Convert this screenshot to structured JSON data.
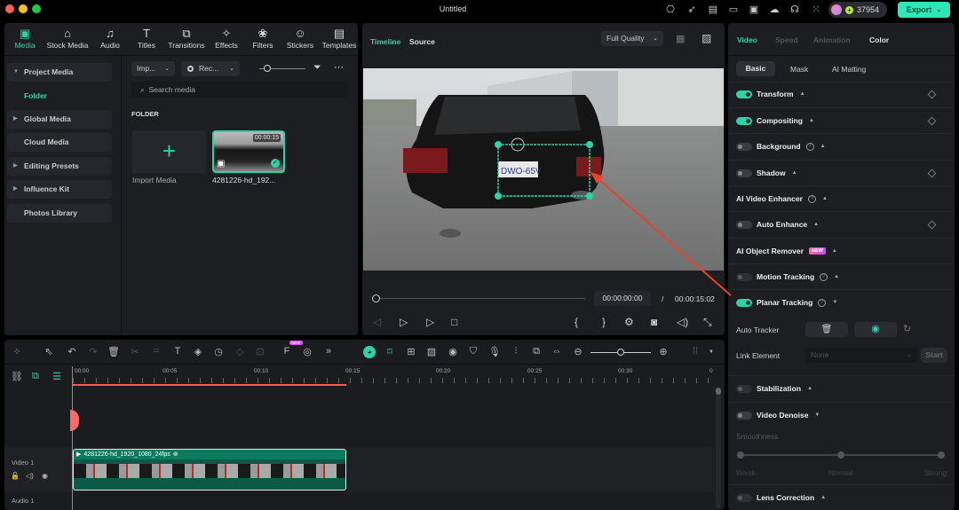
{
  "window": {
    "title": "Untitled"
  },
  "titlebar": {
    "credits": "37954",
    "export_label": "Export",
    "icons": [
      "gift-icon",
      "send-icon",
      "message-icon",
      "layout-icon",
      "save-icon",
      "cloud-upload-icon",
      "headset-icon",
      "apps-icon"
    ]
  },
  "media_tabs": [
    {
      "label": "Media",
      "icon": "▣"
    },
    {
      "label": "Stock Media",
      "icon": "⌂"
    },
    {
      "label": "Audio",
      "icon": "♫"
    },
    {
      "label": "Titles",
      "icon": "T"
    },
    {
      "label": "Transitions",
      "icon": "⧉"
    },
    {
      "label": "Effects",
      "icon": "✧"
    },
    {
      "label": "Filters",
      "icon": "❀"
    },
    {
      "label": "Stickers",
      "icon": "☺"
    },
    {
      "label": "Templates",
      "icon": "▤"
    }
  ],
  "sidebar": {
    "project_media": "Project Media",
    "folder": "Folder",
    "global_media": "Global Media",
    "cloud_media": "Cloud Media",
    "editing_presets": "Editing Presets",
    "influence_kit": "Influence Kit",
    "photos_library": "Photos Library"
  },
  "media": {
    "import_dd": "Imp...",
    "record_dd": "Rec...",
    "search_placeholder": "Search media",
    "folder_heading": "FOLDER",
    "import_label": "Import Media",
    "clip_name": "4281226-hd_192...",
    "clip_duration": "00:00:15"
  },
  "preview": {
    "tab_timeline": "Timeline",
    "tab_source": "Source",
    "quality": "Full Quality",
    "current_time": "00:00:00:00",
    "separator": "/",
    "total_time": "00:00:15:02",
    "plate": "DWO-65V",
    "progress": 0
  },
  "props": {
    "tabs": [
      "Video",
      "Speed",
      "Animation",
      "Color"
    ],
    "subtabs": [
      "Basic",
      "Mask",
      "AI Matting"
    ],
    "transform": "Transform",
    "compositing": "Compositing",
    "background": "Background",
    "shadow": "Shadow",
    "ai_video_enhancer": "AI Video Enhancer",
    "auto_enhance": "Auto Enhance",
    "ai_object_remover": "AI Object Remover",
    "new_badge": "NEW",
    "motion_tracking": "Motion Tracking",
    "planar_tracking": "Planar Tracking",
    "auto_tracker": "Auto Tracker",
    "link_element": "Link Element",
    "link_value": "None",
    "start": "Start",
    "stabilization": "Stabilization",
    "video_denoise": "Video Denoise",
    "smoothness": "Smoothness",
    "weak": "Weak",
    "normal": "Normal",
    "strong": "Strong",
    "lens_correction": "Lens Correction"
  },
  "timeline": {
    "ruler": [
      "00:00",
      "00:05",
      "00:10",
      "00:15",
      "00:20",
      "00:25",
      "00:30",
      "0"
    ],
    "video_track": "Video 1",
    "audio_track": "Audio 1",
    "clip_label": "4281226-hd_1920_1080_24fps",
    "new_badge": "NEW"
  },
  "colors": {
    "accent": "#2ed2a8",
    "playhead": "#ff5c5c",
    "annotation": "#e8442a"
  }
}
